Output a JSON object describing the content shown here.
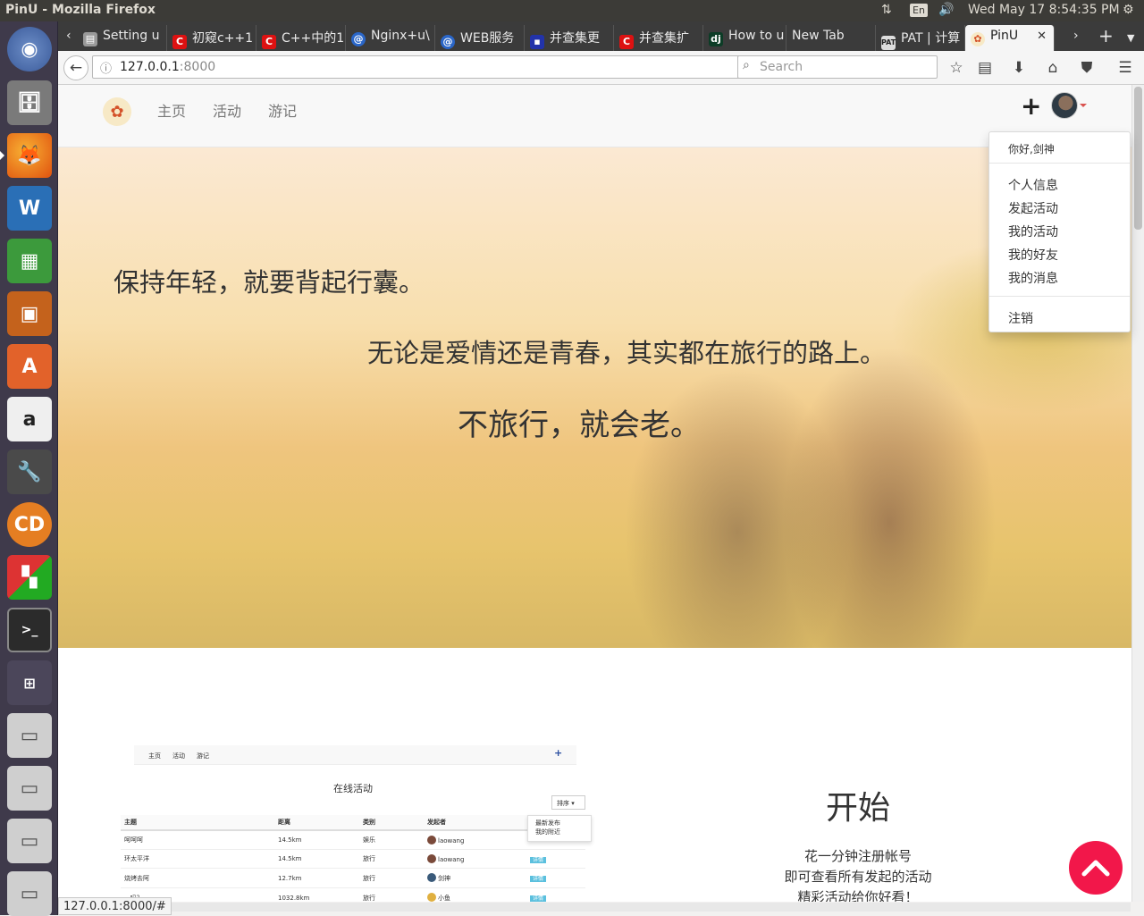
{
  "topbar": {
    "window_title": "PinU - Mozilla Firefox",
    "keyboard_lang": "En",
    "clock": "Wed May 17  8:54:35 PM"
  },
  "launcher": {
    "items": [
      "ubuntu-dash",
      "files",
      "firefox",
      "libreoffice-writer",
      "libreoffice-calc",
      "libreoffice-impress",
      "software-center",
      "amazon",
      "system-settings",
      "codeblocks",
      "app-grid",
      "terminal",
      "workspace-switcher",
      "drive-1",
      "drive-2",
      "drive-3",
      "drive-4"
    ]
  },
  "tabs": [
    {
      "label": "Setting u",
      "icon": "doc-icon"
    },
    {
      "label": "初窥c++1",
      "icon": "c-red-icon"
    },
    {
      "label": "C++中的1",
      "icon": "c-red-icon"
    },
    {
      "label": "Nginx+u\\",
      "icon": "circle-blue-icon"
    },
    {
      "label": "WEB服务",
      "icon": "circle-blue-icon"
    },
    {
      "label": "并查集更",
      "icon": "blue-square-icon"
    },
    {
      "label": "并查集扩",
      "icon": "c-red-icon"
    },
    {
      "label": "How to u",
      "icon": "dj-icon"
    },
    {
      "label": "New Tab",
      "icon": ""
    },
    {
      "label": "PAT | 计算",
      "icon": "pat-icon"
    },
    {
      "label": "PinU",
      "icon": "pinu-icon"
    }
  ],
  "navbar": {
    "url_host": "127.0.0.1",
    "url_port": ":8000",
    "search_placeholder": "Search"
  },
  "site": {
    "nav_links": [
      "主页",
      "活动",
      "游记"
    ],
    "add_symbol": "+",
    "dropdown": {
      "greeting": "你好,剑神",
      "items": [
        "个人信息",
        "发起活动",
        "我的活动",
        "我的好友",
        "我的消息"
      ],
      "logout": "注销"
    },
    "hero": {
      "line1": "保持年轻，就要背起行囊。",
      "line2": "无论是爱情还是青春，其实都在旅行的路上。",
      "line3": "不旅行，就会老。"
    },
    "preview": {
      "nav_links": [
        "主页",
        "活动",
        "游记"
      ],
      "title": "在线活动",
      "sort_label": "排序",
      "sort_options": [
        "最新发布",
        "我的附近"
      ],
      "columns": [
        "主题",
        "距离",
        "类别",
        "发起者",
        ""
      ],
      "rows": [
        {
          "topic": "呵呵呵",
          "distance": "14.5km",
          "category": "娱乐",
          "creator": "laowang",
          "action": ""
        },
        {
          "topic": "环太平洋",
          "distance": "14.5km",
          "category": "旅行",
          "creator": "laowang",
          "action": "详情"
        },
        {
          "topic": "烧烤去阿",
          "distance": "12.7km",
          "category": "旅行",
          "creator": "剑神",
          "action": "详情"
        },
        {
          "topic": "...吗？",
          "distance": "1032.8km",
          "category": "旅行",
          "creator": "小鱼",
          "action": "详情"
        }
      ]
    },
    "start": {
      "heading": "开始",
      "line1": "花一分钟注册帐号",
      "line2": "即可查看所有发起的活动",
      "line3": "精彩活动给你好看！"
    }
  },
  "status_url": "127.0.0.1:8000/#"
}
